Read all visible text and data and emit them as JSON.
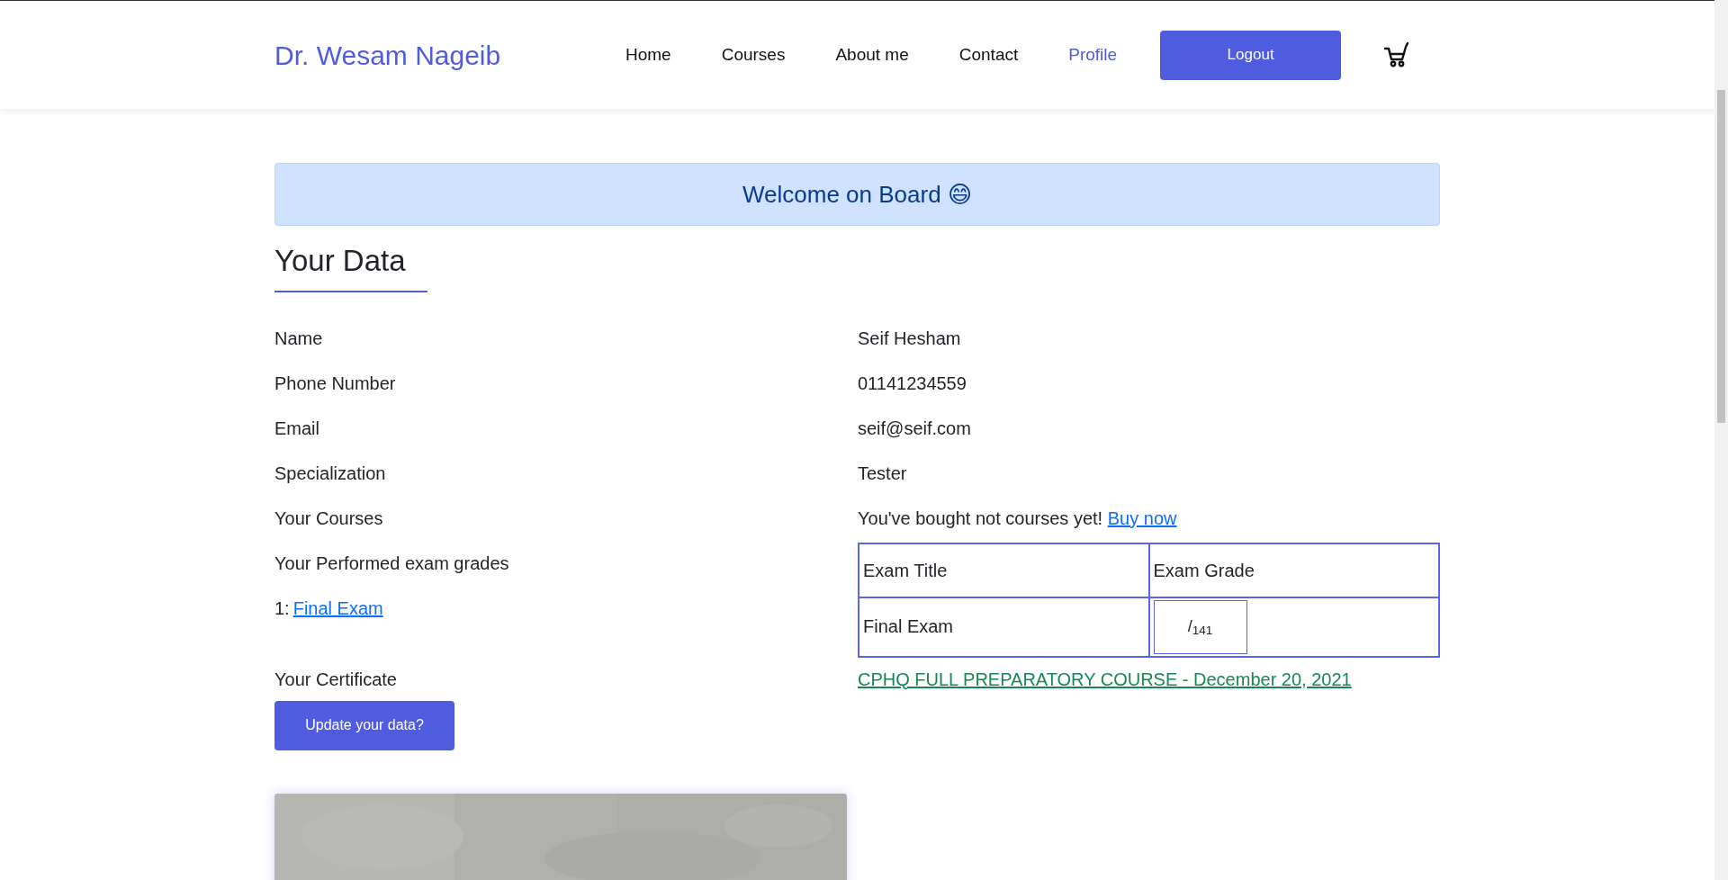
{
  "header": {
    "brand": "Dr. Wesam Nageib",
    "nav": [
      {
        "label": "Home",
        "selected": false
      },
      {
        "label": "Courses",
        "selected": false
      },
      {
        "label": "About me",
        "selected": false
      },
      {
        "label": "Contact",
        "selected": false
      },
      {
        "label": "Profile",
        "selected": true
      }
    ],
    "logout": "Logout"
  },
  "banner": {
    "text": "Welcome on Board",
    "emoji": "😄"
  },
  "section_title": "Your Data",
  "fields": [
    {
      "label": "Name",
      "value": "Seif Hesham"
    },
    {
      "label": "Phone Number",
      "value": "01141234559"
    },
    {
      "label": "Email",
      "value": "seif@seif.com"
    },
    {
      "label": "Specialization",
      "value": "Tester"
    }
  ],
  "courses": {
    "label": "Your Courses",
    "text": "You've bought not courses yet!",
    "link": "Buy now"
  },
  "exams": {
    "label": "Your Performed exam grades",
    "items": [
      {
        "index": "1:",
        "link": "Final Exam"
      }
    ],
    "table": {
      "columns": [
        "Exam Title",
        "Exam Grade"
      ],
      "rows": [
        {
          "title": "Final Exam",
          "grade": "/$_{141}$"
        }
      ]
    }
  },
  "certificate": {
    "label": "Your Certificate",
    "link": "CPHQ FULL PREPARATORY COURSE - December 20, 2021"
  },
  "update_button": "Update your data?"
}
